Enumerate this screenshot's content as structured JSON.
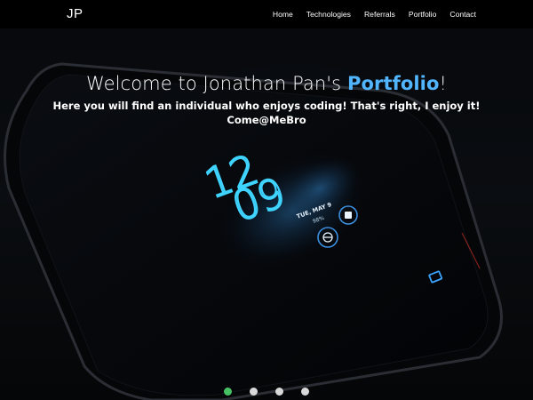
{
  "navbar": {
    "brand": "JP",
    "links": [
      "Home",
      "Technologies",
      "Referrals",
      "Portfolio",
      "Contact"
    ]
  },
  "hero": {
    "headline_prefix": "Welcome to Jonathan Pan's ",
    "headline_accent": "Portfolio",
    "headline_suffix": "!",
    "subline_1": "Here you will find an individual who enjoys coding! That's right, I enjoy it!",
    "subline_2": "Come@MeBro",
    "phone_hour": "12",
    "phone_minute": "09",
    "phone_date": "TUE, MAY 9",
    "phone_battery": "98%"
  },
  "carousel": {
    "slide_count": 4,
    "active_index": 0,
    "active_color": "#45c163",
    "inactive_color": "#d9d9d9"
  },
  "colors": {
    "accent": "#52b5ff",
    "clock": "#3fd3ff",
    "navbar_bg": "#000000"
  }
}
